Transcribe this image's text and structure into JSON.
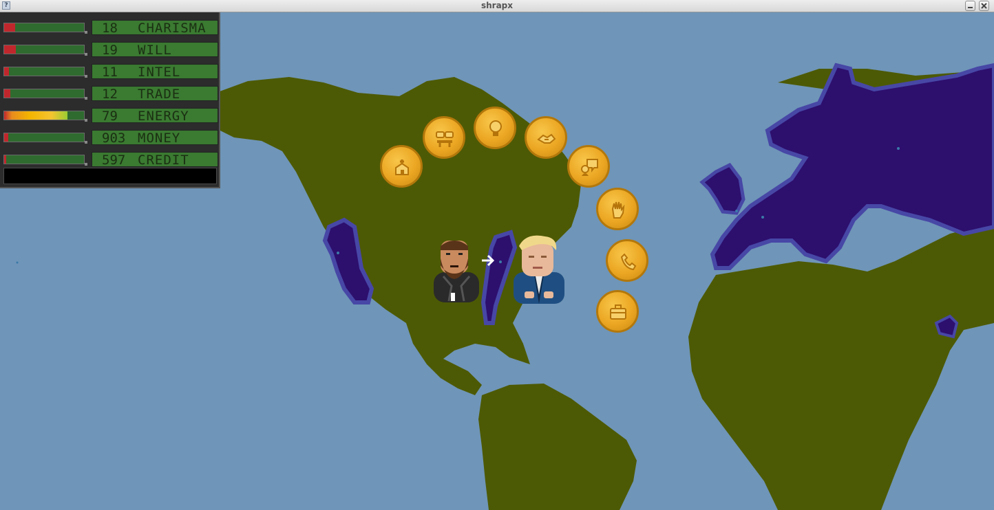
{
  "window": {
    "title": "shrapx"
  },
  "stats": [
    {
      "value": "18",
      "name": "CHARISMA",
      "level": 0.14
    },
    {
      "value": "19",
      "name": "WILL",
      "level": 0.15
    },
    {
      "value": "11",
      "name": "INTEL",
      "level": 0.06
    },
    {
      "value": "12",
      "name": "TRADE",
      "level": 0.08
    },
    {
      "value": "79",
      "name": "ENERGY",
      "level": 0.79
    },
    {
      "value": "903",
      "name": "MONEY",
      "level": 0.05
    },
    {
      "value": "597",
      "name": "CREDIT",
      "level": 0.03
    }
  ],
  "log": {
    "text": ""
  },
  "actions": [
    {
      "icon": "home-icon"
    },
    {
      "icon": "meeting-icon"
    },
    {
      "icon": "lightbulb-icon"
    },
    {
      "icon": "handshake-icon"
    },
    {
      "icon": "chat-icon"
    },
    {
      "icon": "hand-icon"
    },
    {
      "icon": "phone-icon"
    },
    {
      "icon": "briefcase-icon"
    }
  ],
  "characters": [
    {
      "name": "player-character"
    },
    {
      "name": "rival-character"
    }
  ],
  "colors": {
    "ocean": "#6f95b8",
    "land": "#4d5a05",
    "territory": "#2d0f6e",
    "territory_border": "#4747a6",
    "coin": "#eba622",
    "stat_bar": "#3a7a31"
  }
}
